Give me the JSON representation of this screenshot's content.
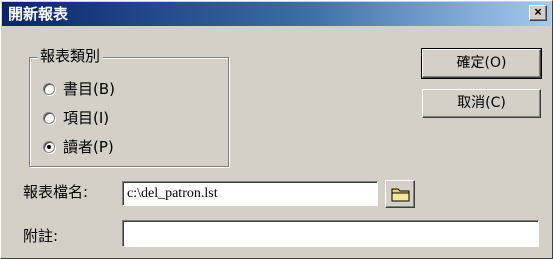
{
  "dialog": {
    "title": "開新報表",
    "close_glyph": "×"
  },
  "report_type": {
    "group_label": "報表類別",
    "options": [
      {
        "label": "書目(B)",
        "checked": false
      },
      {
        "label": "項目(I)",
        "checked": false
      },
      {
        "label": "讀者(P)",
        "checked": true
      }
    ]
  },
  "buttons": {
    "ok_label": "確定(O)",
    "cancel_label": "取消(C)"
  },
  "form": {
    "filename_label": "報表檔名:",
    "filename_value": "c:\\del_patron.lst",
    "note_label": "附註:",
    "note_value": ""
  },
  "icons": {
    "browse": "folder-icon",
    "close": "close-icon"
  }
}
